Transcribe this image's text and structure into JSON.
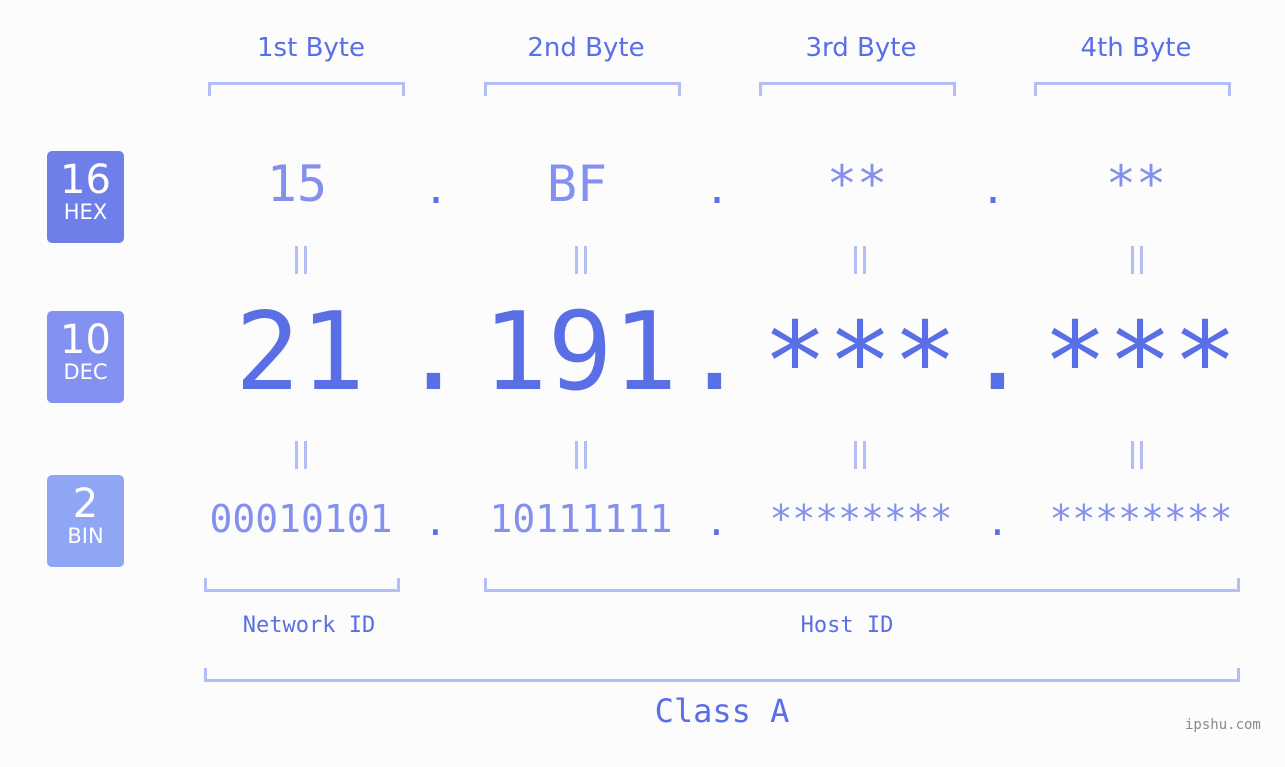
{
  "bytes": [
    {
      "header": "1st Byte",
      "hex": "15",
      "dec": "21",
      "bin": "00010101"
    },
    {
      "header": "2nd Byte",
      "hex": "BF",
      "dec": "191",
      "bin": "10111111"
    },
    {
      "header": "3rd Byte",
      "hex": "**",
      "dec": "***",
      "bin": "********"
    },
    {
      "header": "4th Byte",
      "hex": "**",
      "dec": "***",
      "bin": "********"
    }
  ],
  "separator": ".",
  "rows": {
    "hex": {
      "base": "16",
      "label": "HEX",
      "color": "#6f7fe9"
    },
    "dec": {
      "base": "10",
      "label": "DEC",
      "color": "#8391f0"
    },
    "bin": {
      "base": "2",
      "label": "BIN",
      "color": "#8fa6f5"
    }
  },
  "segments": {
    "network": "Network ID",
    "host": "Host ID",
    "class": "Class A"
  },
  "footer": {
    "site": "ipshu.com"
  },
  "colors": {
    "primary": "#5a6ee6",
    "secondary": "#8490ee",
    "bracket": "#b3bdf6",
    "background": "#fbfcfb"
  }
}
